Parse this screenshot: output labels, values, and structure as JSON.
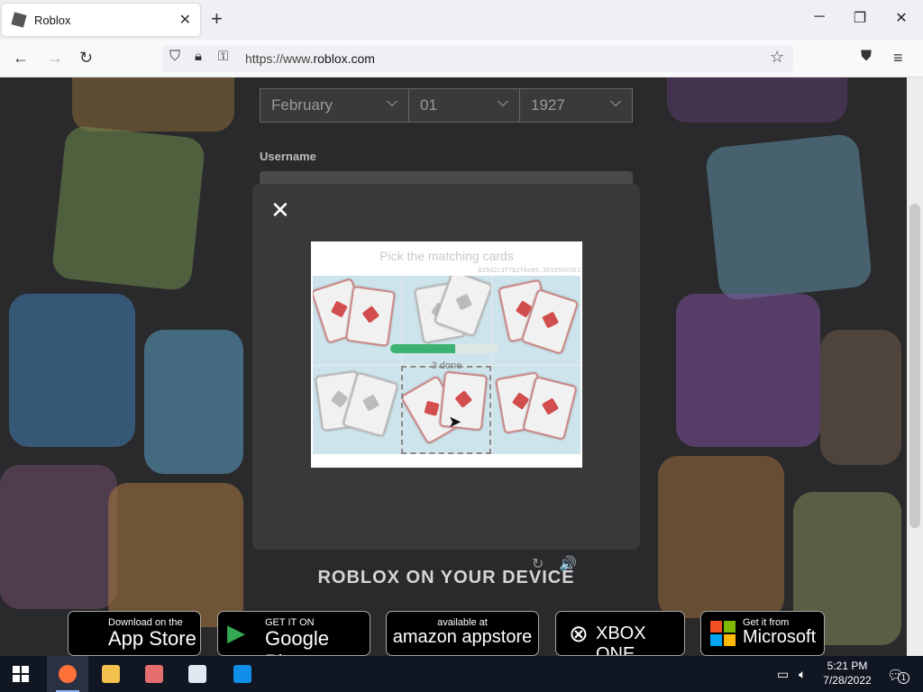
{
  "browser": {
    "tab_title": "Roblox",
    "tab_close": "✕",
    "new_tab": "+",
    "url_scheme": "https://www.",
    "url_domain": "roblox.com",
    "window_buttons": [
      "─",
      "❐",
      "✕"
    ],
    "nav_icons": [
      "back-arrow-icon",
      "forward-arrow-icon",
      "reload-icon",
      "shield-icon",
      "lock-icon",
      "key-icon",
      "star-icon",
      "pocket-icon",
      "menu-icon"
    ]
  },
  "signup": {
    "birthday": {
      "month": "February",
      "day": "01",
      "year": "1927"
    },
    "username_label": "Username"
  },
  "captcha": {
    "close": "✕",
    "heading": "Pick the matching cards",
    "code": "829d2c3f7b2f6e89.3016508301",
    "progress": 0.6,
    "progress_text": "3 done",
    "refresh_icon": "↻",
    "audio_icon": "🔊"
  },
  "device_section": {
    "title": "ROBLOX ON YOUR DEVICE",
    "badges": [
      {
        "small": "Download on the",
        "large": "App Store",
        "icon": ""
      },
      {
        "small": "GET IT ON",
        "large": "Google Play",
        "icon": "▶"
      },
      {
        "small": "available at",
        "large": "amazon appstore",
        "icon": ""
      },
      {
        "small": "",
        "large": "XBOX ONE",
        "icon": "⊗"
      },
      {
        "small": "Get it from",
        "large": "Microsoft",
        "icon": ""
      }
    ]
  },
  "taskbar": {
    "time": "5:21 PM",
    "date": "7/28/2022",
    "notification_count": "1",
    "apps": [
      "windows-start",
      "firefox",
      "file-explorer",
      "paint",
      "app-window",
      "teamviewer"
    ]
  },
  "colors": {
    "accent_green": "#3cb371",
    "card_symbol": "#d24d4d",
    "taskbar": "#101622"
  }
}
